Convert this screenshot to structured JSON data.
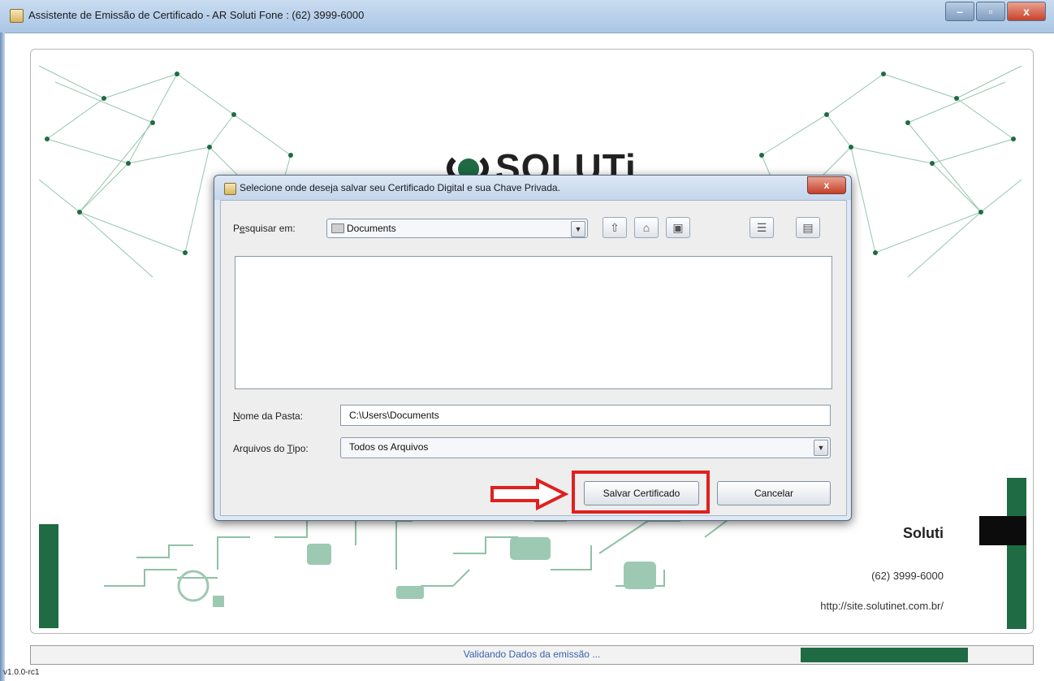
{
  "window": {
    "title": "Assistente de Emissão de Certificado - AR Soluti Fone : (62) 3999-6000",
    "min_label": "–",
    "max_label": "▫",
    "close_label": "x"
  },
  "brand": {
    "logo_text": "SOLUTi"
  },
  "contact": {
    "company": "Soluti",
    "phone": "(62) 3999-6000",
    "site": "http://site.solutinet.com.br/"
  },
  "status": {
    "text": "Validando Dados da emissão ..."
  },
  "version": "v1.0.0-rc1",
  "dialog": {
    "title": "Selecione onde deseja salvar seu Certificado Digital e sua Chave Privada.",
    "close_label": "x",
    "lookin_label_pre": "P",
    "lookin_label_mid": "e",
    "lookin_label_post": "squisar em:",
    "lookin_value": "Documents",
    "folder_label_pre": "N",
    "folder_label_post": "ome da Pasta:",
    "folder_value": "C:\\Users\\Documents",
    "type_label_pre": "Arquivos do ",
    "type_label_mid": "T",
    "type_label_post": "ipo:",
    "type_value": "Todos os Arquivos",
    "save_button": "Salvar Certificado",
    "cancel_button": "Cancelar"
  },
  "icons": [
    "folder-up-icon",
    "home-icon",
    "new-folder-icon",
    "list-view-icon",
    "details-view-icon"
  ],
  "colors": {
    "brand_green": "#1f6b43",
    "highlight_red": "#e02020",
    "status_text": "#3a62b0"
  }
}
